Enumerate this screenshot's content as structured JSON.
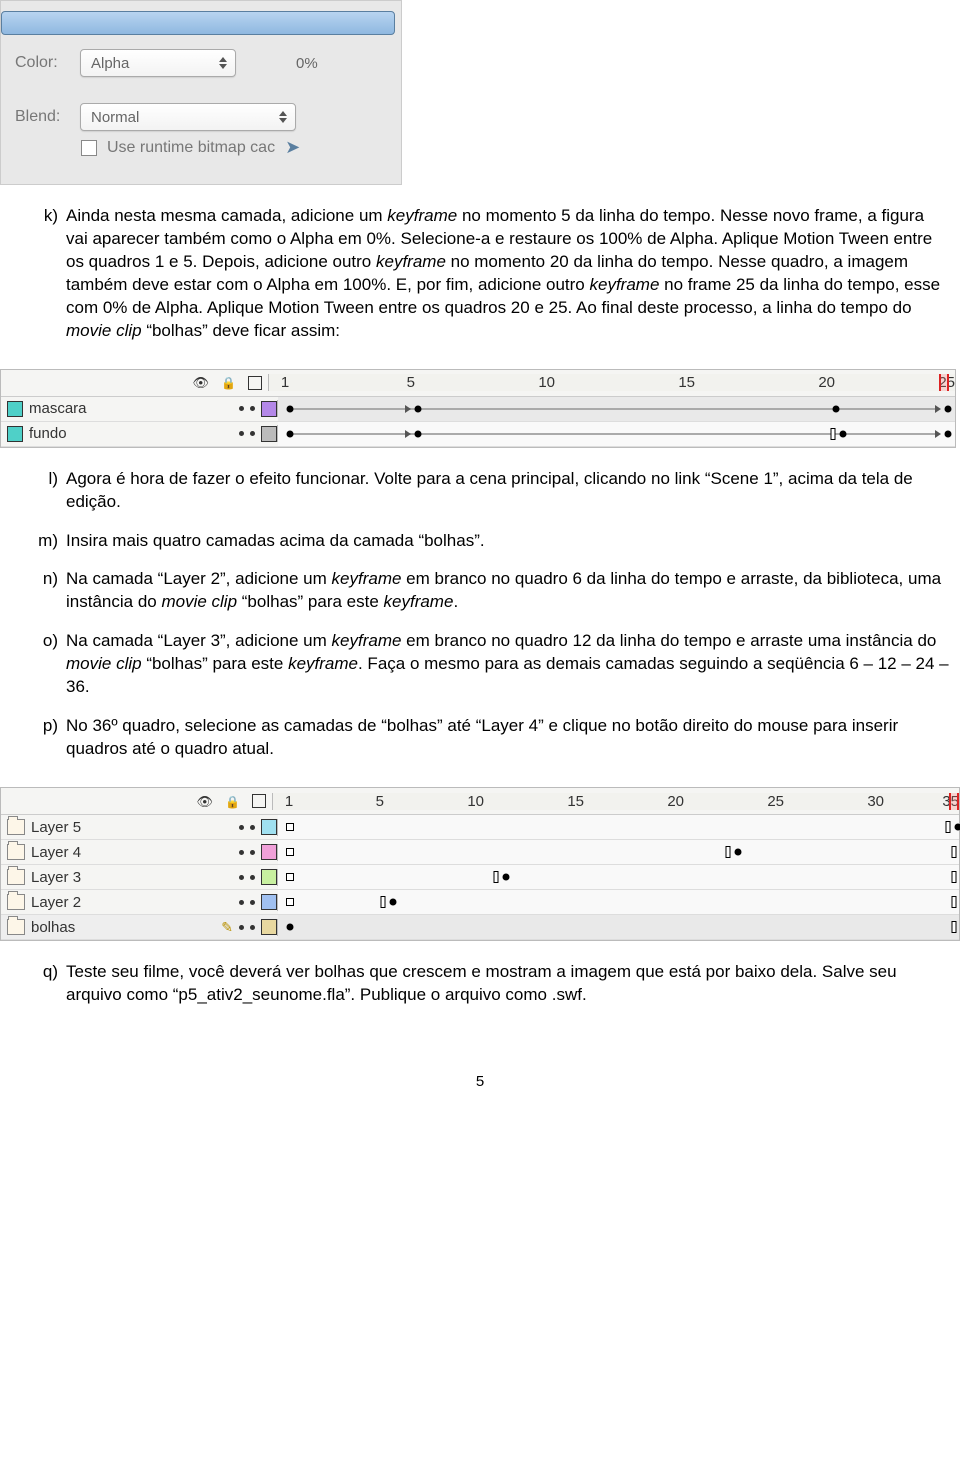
{
  "panel": {
    "color_label": "Color:",
    "color_value": "Alpha",
    "pct": "0%",
    "blend_label": "Blend:",
    "blend_value": "Normal",
    "runtime_label": "Use runtime bitmap cac"
  },
  "items": {
    "k": {
      "letter": "k)",
      "html": "Ainda nesta mesma camada, adicione um <em>keyframe</em> no momento 5 da linha do tempo. Nesse novo frame, a figura vai aparecer também como o Alpha em 0%. Selecione-a e restaure os 100% de Alpha. Aplique Motion Tween entre os quadros 1 e 5. Depois, adicione outro <em>keyframe</em> no momento 20 da linha do tempo. Nesse quadro, a imagem também deve estar com o Alpha em 100%. E, por fim, adicione outro <em>keyframe</em> no frame 25 da linha do tempo, esse com 0% de Alpha. Aplique Motion Tween entre os quadros 20 e 25. Ao final deste processo, a linha do tempo do <em>movie clip</em> “bolhas” deve ficar assim:"
    },
    "l": {
      "letter": "l)",
      "html": "Agora é hora de fazer o efeito funcionar. Volte para a cena principal, clicando no link “Scene 1”, acima da tela de edição."
    },
    "m": {
      "letter": "m)",
      "html": "Insira mais quatro camadas acima da camada “bolhas”."
    },
    "n": {
      "letter": "n)",
      "html": "Na camada “Layer 2”, adicione um <em>keyframe</em> em branco no quadro 6 da linha do tempo e arraste, da biblioteca, uma instância do <em>movie clip</em> “bolhas” para este <em>keyframe</em>."
    },
    "o": {
      "letter": "o)",
      "html": "Na camada “Layer 3”, adicione um <em>keyframe</em> em branco no quadro 12 da linha do tempo e arraste uma instância do <em>movie clip</em> “bolhas” para este <em>keyframe</em>. Faça o mesmo para as demais camadas seguindo a seqüência 6 – 12 – 24 – 36."
    },
    "p": {
      "letter": "p)",
      "html": "No 36º quadro, selecione as camadas de “bolhas” até “Layer 4” e clique no botão direito do mouse para inserir quadros até o quadro atual."
    },
    "q": {
      "letter": "q)",
      "html": "Teste seu filme, você deverá ver bolhas que crescem e mostram a imagem que está por baixo dela. Salve seu arquivo como “p5_ativ2_seunome.fla”. Publique o arquivo como .swf."
    }
  },
  "timeline1": {
    "ticks": [
      "1",
      "5",
      "10",
      "15",
      "20",
      "25"
    ],
    "layers": {
      "mascara": "mascara",
      "fundo": "fundo"
    }
  },
  "timeline2": {
    "ticks": [
      "1",
      "5",
      "10",
      "15",
      "20",
      "25",
      "30",
      "35"
    ],
    "layers": {
      "l5": "Layer 5",
      "l4": "Layer 4",
      "l3": "Layer 3",
      "l2": "Layer 2",
      "bolhas": "bolhas"
    }
  },
  "colors": {
    "teal": "#4fd0c8",
    "violet": "#b488e8",
    "grey": "#bbbbbb",
    "cyan": "#a0e0f0",
    "pink": "#f0a0d8",
    "lime": "#c8f0a0",
    "blue": "#a0c0f0",
    "sand": "#e8d8a0"
  },
  "page_number": "5"
}
